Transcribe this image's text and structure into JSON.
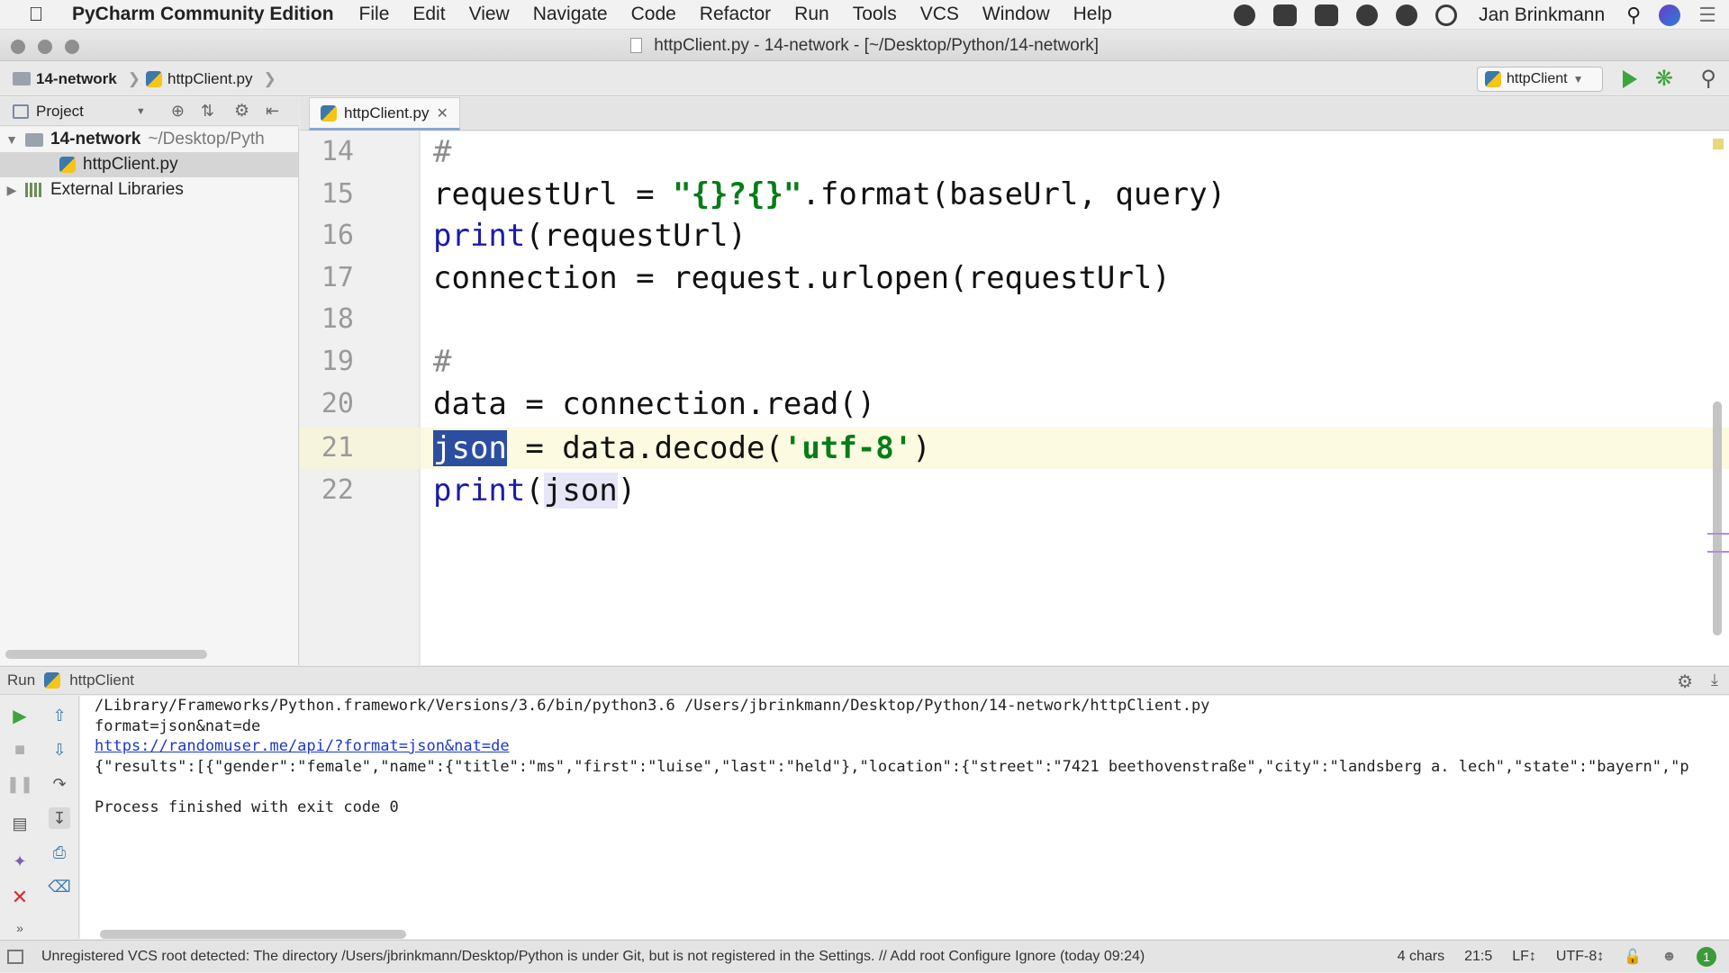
{
  "menubar": {
    "app_name": "PyCharm Community Edition",
    "items": [
      "File",
      "Edit",
      "View",
      "Navigate",
      "Code",
      "Refactor",
      "Run",
      "Tools",
      "VCS",
      "Window",
      "Help"
    ],
    "user": "Jan Brinkmann"
  },
  "window": {
    "title": "httpClient.py - 14-network - [~/Desktop/Python/14-network]"
  },
  "navbar": {
    "breadcrumb_project": "14-network",
    "breadcrumb_file": "httpClient.py",
    "run_config": "httpClient"
  },
  "project": {
    "header_label": "Project",
    "root_name": "14-network",
    "root_path": "~/Desktop/Pyth",
    "file_name": "httpClient.py",
    "libraries": "External Libraries"
  },
  "editor": {
    "tab_label": "httpClient.py",
    "lines": [
      {
        "no": "14",
        "text": "#"
      },
      {
        "no": "15",
        "text": "requestUrl = \"{}?{}\".format(baseUrl, query)"
      },
      {
        "no": "16",
        "text": "print(requestUrl)"
      },
      {
        "no": "17",
        "text": "connection = request.urlopen(requestUrl)"
      },
      {
        "no": "18",
        "text": ""
      },
      {
        "no": "19",
        "text": "#"
      },
      {
        "no": "20",
        "text": "data = connection.read()"
      },
      {
        "no": "21",
        "text": "json = data.decode('utf-8')"
      },
      {
        "no": "22",
        "text": "print(json)"
      }
    ]
  },
  "run": {
    "label": "Run",
    "config": "httpClient",
    "console": [
      "/Library/Frameworks/Python.framework/Versions/3.6/bin/python3.6 /Users/jbrinkmann/Desktop/Python/14-network/httpClient.py",
      "format=json&nat=de",
      "https://randomuser.me/api/?format=json&nat=de",
      "{\"results\":[{\"gender\":\"female\",\"name\":{\"title\":\"ms\",\"first\":\"luise\",\"last\":\"held\"},\"location\":{\"street\":\"7421 beethovenstraße\",\"city\":\"landsberg a. lech\",\"state\":\"bayern\",\"p",
      "",
      "Process finished with exit code 0"
    ]
  },
  "status": {
    "message": "Unregistered VCS root detected: The directory /Users/jbrinkmann/Desktop/Python is under Git, but is not registered in the Settings. // Add root  Configure  Ignore (today 09:24)",
    "selection": "4 chars",
    "position": "21:5",
    "line_sep": "LF↕",
    "encoding": "UTF-8↕",
    "notifications": "1"
  }
}
